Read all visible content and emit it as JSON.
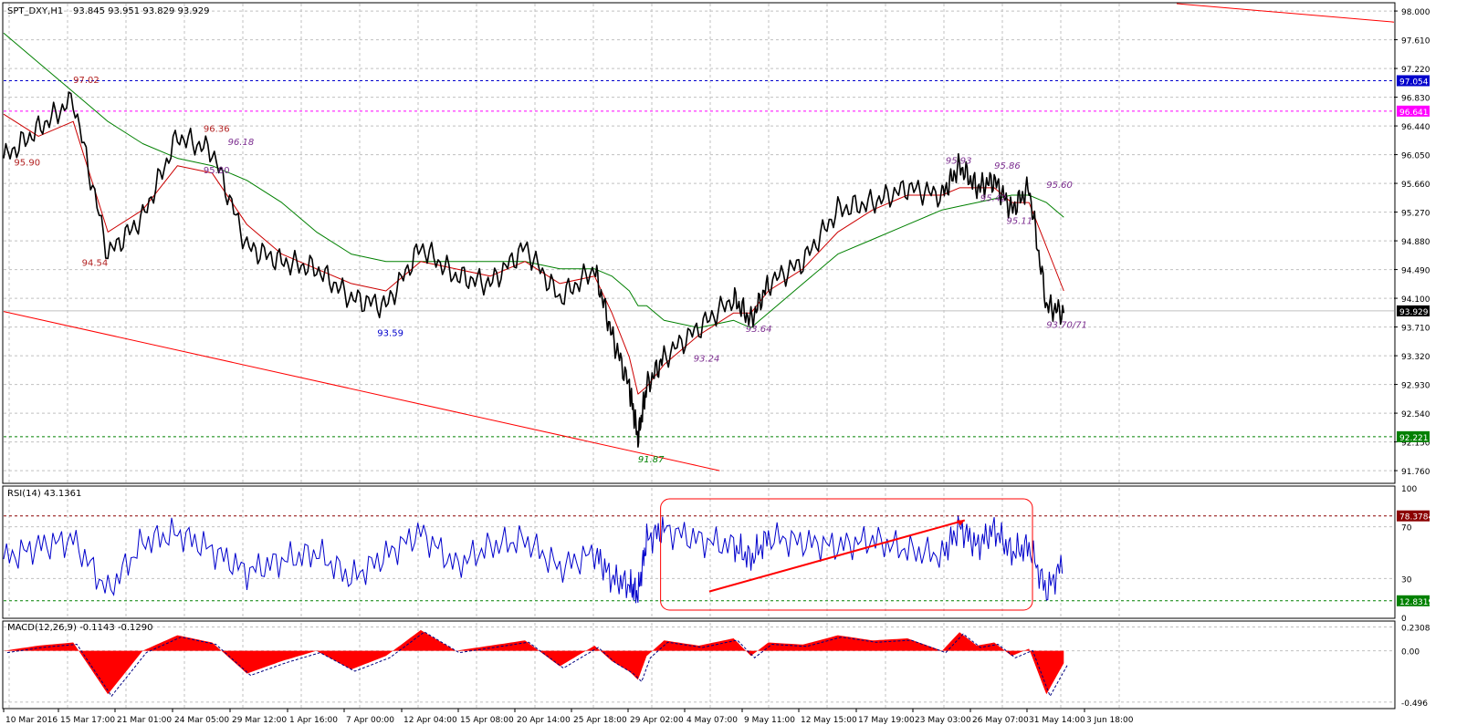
{
  "header": {
    "symbol_label": "SPT_DXY,H1",
    "ohlc": "93.845 93.951 93.829 93.929"
  },
  "main_axis": {
    "ylim": [
      91.6,
      98.1
    ],
    "ticks": [
      "98.000",
      "97.610",
      "97.220",
      "96.830",
      "96.440",
      "96.050",
      "95.660",
      "95.270",
      "94.880",
      "94.490",
      "94.100",
      "93.710",
      "93.320",
      "92.930",
      "92.540",
      "92.150",
      "91.760"
    ]
  },
  "price_tags": [
    {
      "label": "97.054",
      "value": 97.054,
      "color": "#0000cc"
    },
    {
      "label": "96.641",
      "value": 96.641,
      "color": "#ff00ff"
    },
    {
      "label": "93.929",
      "value": 93.929,
      "color": "#000000"
    },
    {
      "label": "92.221",
      "value": 92.221,
      "color": "#008000"
    }
  ],
  "annotations": [
    {
      "text": "97.02",
      "x": 40,
      "y": 97.02,
      "color": "#b22222",
      "italic": false
    },
    {
      "text": "96.36",
      "x": 115,
      "y": 96.36,
      "color": "#b22222",
      "italic": false
    },
    {
      "text": "96.18",
      "x": 129,
      "y": 96.18,
      "color": "#7b2d8f",
      "italic": true
    },
    {
      "text": "95.90",
      "x": 6,
      "y": 95.9,
      "color": "#b22222",
      "italic": false
    },
    {
      "text": "95.80",
      "x": 115,
      "y": 95.8,
      "color": "#7b2d8f",
      "italic": false
    },
    {
      "text": "94.54",
      "x": 45,
      "y": 94.54,
      "color": "#b22222",
      "italic": false
    },
    {
      "text": "93.59",
      "x": 215,
      "y": 93.59,
      "color": "#0000cc",
      "italic": false
    },
    {
      "text": "91.87",
      "x": 365,
      "y": 91.87,
      "color": "#008000",
      "italic": true
    },
    {
      "text": "93.24",
      "x": 397,
      "y": 93.24,
      "color": "#7b2d8f",
      "italic": true
    },
    {
      "text": "93.64",
      "x": 427,
      "y": 93.64,
      "color": "#7b2d8f",
      "italic": true
    },
    {
      "text": "95.93",
      "x": 542,
      "y": 95.93,
      "color": "#7b2d8f",
      "italic": true
    },
    {
      "text": "95.86",
      "x": 570,
      "y": 95.86,
      "color": "#7b2d8f",
      "italic": true
    },
    {
      "text": "95.60",
      "x": 600,
      "y": 95.6,
      "color": "#7b2d8f",
      "italic": true
    },
    {
      "text": "95.42",
      "x": 562,
      "y": 95.42,
      "color": "#7b2d8f",
      "italic": true
    },
    {
      "text": "95.11",
      "x": 577,
      "y": 95.11,
      "color": "#7b2d8f",
      "italic": true
    },
    {
      "text": "93.70/71",
      "x": 600,
      "y": 93.7,
      "color": "#7b2d8f",
      "italic": true
    }
  ],
  "rsi": {
    "label": "RSI(14) 43.1361",
    "ylim": [
      0,
      100
    ],
    "ticks": [
      "100",
      "70",
      "30",
      "0"
    ],
    "tags": [
      {
        "label": "78.3784",
        "value": 78.3784,
        "color": "#8b0000"
      },
      {
        "label": "12.8319",
        "value": 12.8319,
        "color": "#008000"
      }
    ]
  },
  "macd": {
    "label": "MACD(12,26,9) -0.1143 -0.1290",
    "ylim": [
      -0.55,
      0.27
    ],
    "ticks": [
      "0.2308",
      "0.00",
      "-0.496"
    ]
  },
  "time_labels": [
    "10 Mar 2016",
    "15 Mar 17:00",
    "21 Mar 01:00",
    "24 Mar 05:00",
    "29 Mar 12:00",
    "1 Apr 16:00",
    "7 Apr 00:00",
    "12 Apr 04:00",
    "15 Apr 08:00",
    "20 Apr 14:00",
    "25 Apr 18:00",
    "29 Apr 02:00",
    "4 May 07:00",
    "9 May 11:00",
    "12 May 15:00",
    "17 May 19:00",
    "23 May 03:00",
    "26 May 07:00",
    "31 May 14:00",
    "3 Jun 18:00"
  ],
  "chart_data": {
    "type": "line",
    "title": "SPT_DXY,H1 93.845 93.951 93.829 93.929",
    "x": [
      0,
      20,
      40,
      60,
      80,
      100,
      120,
      140,
      160,
      180,
      200,
      220,
      240,
      260,
      280,
      300,
      320,
      340,
      350,
      360,
      365,
      370,
      380,
      400,
      420,
      430,
      440,
      460,
      480,
      500,
      520,
      540,
      550,
      560,
      570,
      580,
      590,
      600,
      610
    ],
    "series": [
      {
        "values": [
          96.0,
          96.4,
          96.8,
          94.7,
          95.2,
          96.3,
          96.1,
          94.8,
          94.6,
          94.5,
          94.1,
          94.0,
          94.8,
          94.4,
          94.3,
          94.8,
          94.1,
          94.5,
          93.6,
          92.9,
          92.2,
          92.9,
          93.3,
          93.7,
          94.1,
          93.8,
          94.3,
          94.6,
          95.3,
          95.4,
          95.6,
          95.5,
          95.9,
          95.6,
          95.7,
          95.3,
          95.6,
          94.0,
          93.9
        ]
      },
      {
        "values": [
          96.6,
          96.3,
          96.5,
          95.0,
          95.3,
          95.9,
          95.8,
          95.1,
          94.7,
          94.5,
          94.3,
          94.2,
          94.6,
          94.5,
          94.4,
          94.6,
          94.3,
          94.4,
          93.9,
          93.3,
          92.8,
          92.9,
          93.2,
          93.6,
          93.9,
          93.9,
          94.2,
          94.5,
          95.0,
          95.3,
          95.5,
          95.5,
          95.6,
          95.6,
          95.6,
          95.4,
          95.4,
          94.8,
          94.2
        ]
      },
      {
        "values": [
          97.7,
          97.3,
          96.9,
          96.5,
          96.2,
          96.0,
          95.9,
          95.7,
          95.4,
          95.0,
          94.7,
          94.6,
          94.6,
          94.6,
          94.6,
          94.6,
          94.5,
          94.5,
          94.4,
          94.2,
          94.0,
          94.0,
          93.8,
          93.7,
          93.8,
          93.7,
          93.9,
          94.3,
          94.7,
          94.9,
          95.1,
          95.3,
          95.35,
          95.4,
          95.45,
          95.5,
          95.5,
          95.4,
          95.2
        ]
      }
    ],
    "rsi_values": [
      45,
      55,
      60,
      20,
      58,
      65,
      52,
      35,
      44,
      50,
      30,
      48,
      66,
      40,
      55,
      60,
      38,
      50,
      30,
      25,
      18,
      60,
      68,
      60,
      55,
      45,
      62,
      58,
      55,
      60,
      52,
      48,
      70,
      55,
      68,
      50,
      55,
      20,
      43
    ],
    "macd_values": [
      0.0,
      0.05,
      0.08,
      -0.42,
      0.0,
      0.15,
      0.08,
      -0.22,
      -0.1,
      0.0,
      -0.18,
      -0.05,
      0.2,
      0.0,
      0.05,
      0.1,
      -0.15,
      0.05,
      -0.1,
      -0.2,
      -0.28,
      -0.05,
      0.1,
      0.05,
      0.12,
      -0.05,
      0.08,
      0.06,
      0.15,
      0.1,
      0.12,
      0.0,
      0.18,
      0.05,
      0.08,
      -0.05,
      0.02,
      -0.42,
      -0.12
    ]
  }
}
